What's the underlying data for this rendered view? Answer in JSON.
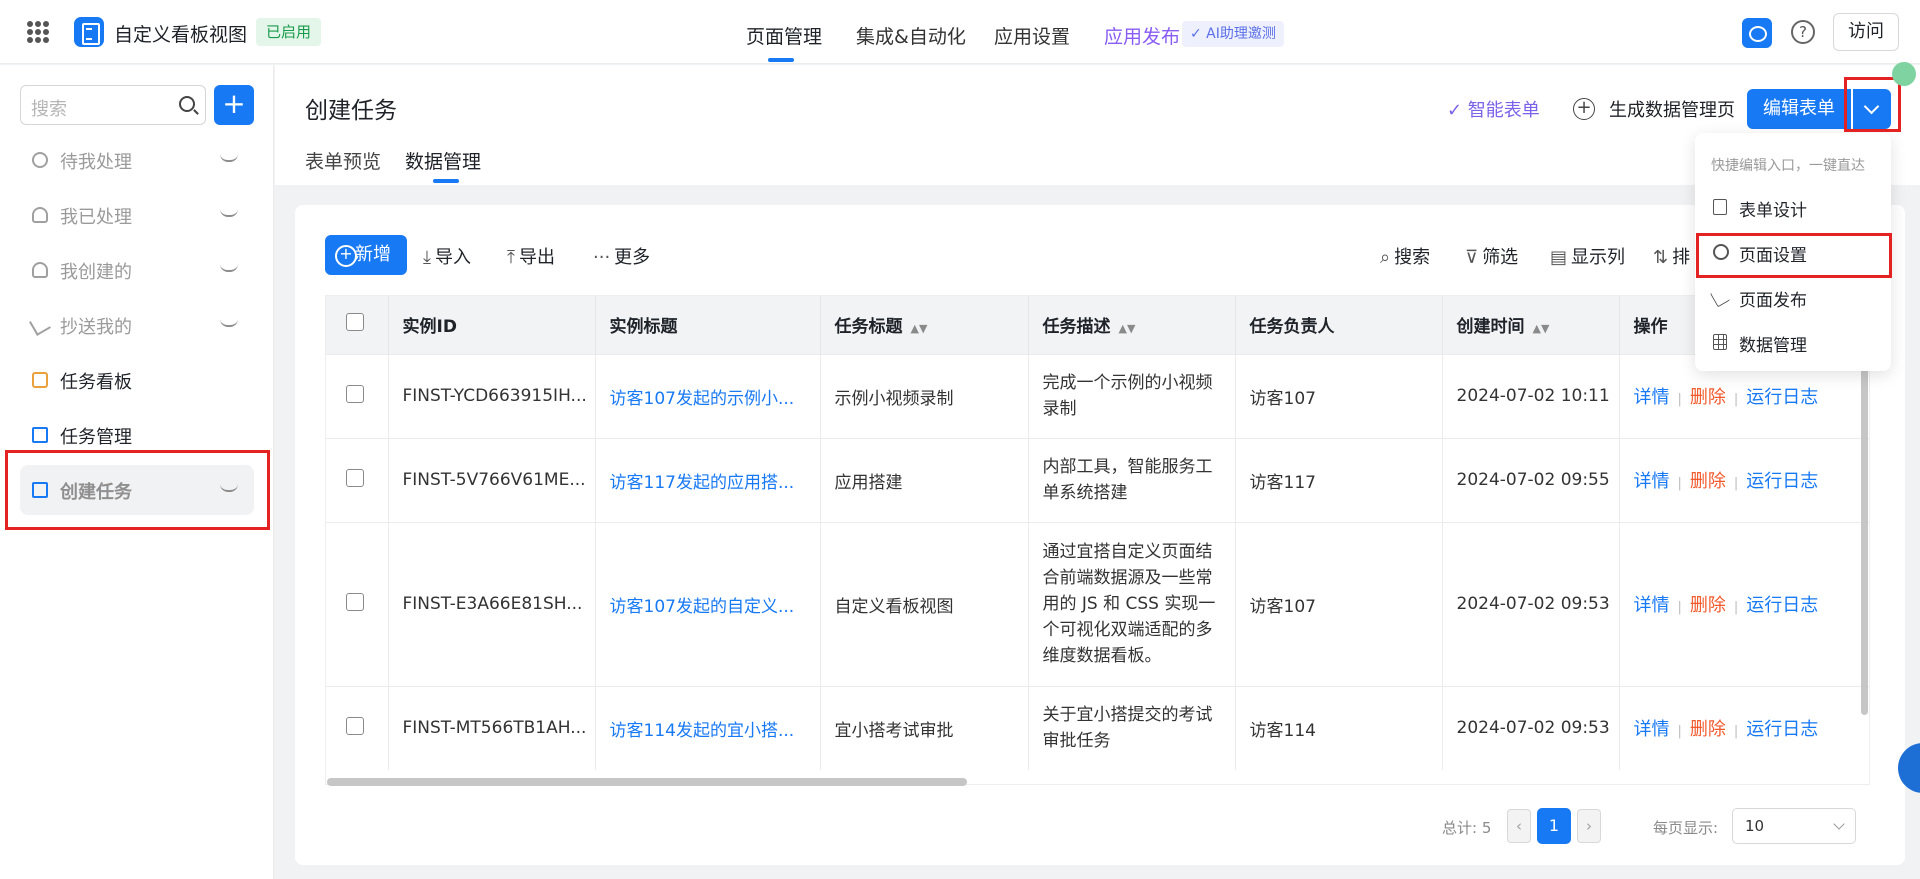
{
  "app": {
    "title": "自定义看板视图",
    "status": "已启用"
  },
  "topnav": {
    "items": [
      "页面管理",
      "集成&自动化",
      "应用设置",
      "应用发布"
    ],
    "ai_badge": "✓ AI助理邀测",
    "visit": "访问"
  },
  "sidebar": {
    "search_placeholder": "搜索",
    "add": "+",
    "items": [
      {
        "label": "待我处理",
        "icon": "clock-icon"
      },
      {
        "label": "我已处理",
        "icon": "user-check-icon"
      },
      {
        "label": "我创建的",
        "icon": "user-icon"
      },
      {
        "label": "抄送我的",
        "icon": "send-icon"
      },
      {
        "label": "任务看板",
        "icon": "board-icon"
      },
      {
        "label": "任务管理",
        "icon": "list-icon"
      },
      {
        "label": "创建任务",
        "icon": "doc-icon"
      }
    ]
  },
  "page": {
    "title": "创建任务",
    "tabs": [
      "表单预览",
      "数据管理"
    ],
    "smart_form": "✓ 智能表单",
    "gen_page": "生成数据管理页",
    "edit_form": "编辑表单"
  },
  "toolbar": {
    "new": "新增",
    "import": "导入",
    "export": "导出",
    "more": "更多",
    "search": "搜索",
    "filter": "筛选",
    "columns": "显示列",
    "sort": "排"
  },
  "table": {
    "headers": [
      "实例ID",
      "实例标题",
      "任务标题",
      "任务描述",
      "任务负责人",
      "创建时间",
      "操作"
    ],
    "rows": [
      {
        "id": "FINST-YCD663915IH...",
        "title": "访客107发起的示例小...",
        "task": "示例小视频录制",
        "desc": "完成一个示例的小视频录制",
        "owner": "访客107",
        "time": "2024-07-02 10:11"
      },
      {
        "id": "FINST-5V766V61ME...",
        "title": "访客117发起的应用搭...",
        "task": "应用搭建",
        "desc": "内部工具，智能服务工单系统搭建",
        "owner": "访客117",
        "time": "2024-07-02 09:55"
      },
      {
        "id": "FINST-E3A66E81SH...",
        "title": "访客107发起的自定义...",
        "task": "自定义看板视图",
        "desc": "通过宜搭自定义页面结合前端数据源及一些常用的 JS 和 CSS 实现一个可视化双端适配的多维度数据看板。",
        "owner": "访客107",
        "time": "2024-07-02 09:53"
      },
      {
        "id": "FINST-MT566TB1AH...",
        "title": "访客114发起的宜小搭...",
        "task": "宜小搭考试审批",
        "desc": "关于宜小搭提交的考试审批任务",
        "owner": "访客114",
        "time": "2024-07-02 09:53"
      }
    ],
    "ops": {
      "detail": "详情",
      "delete": "删除",
      "log": "运行日志"
    }
  },
  "pager": {
    "total": "总计: 5",
    "current": "1",
    "per_page_label": "每页显示:",
    "per_page": "10"
  },
  "dropdown": {
    "hint": "快捷编辑入口，一键直达",
    "items": [
      "表单设计",
      "页面设置",
      "页面发布",
      "数据管理"
    ]
  },
  "colors": {
    "primary": "#1879f4",
    "danger": "#f25a2c",
    "highlight": "#e52222",
    "status_green": "#1a9b4b"
  }
}
